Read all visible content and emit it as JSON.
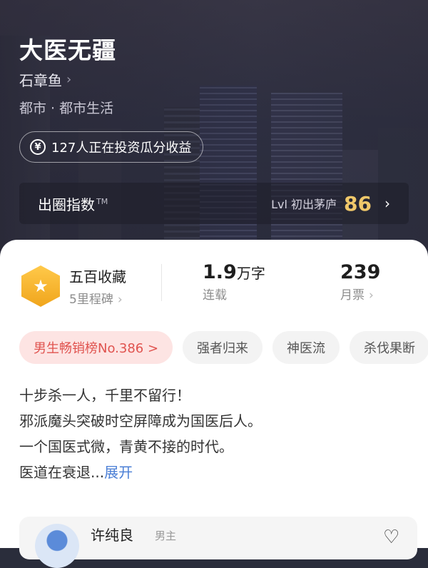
{
  "book": {
    "title": "大医无疆",
    "author": "石章鱼",
    "genre": "都市 · 都市生活",
    "invest_text": "127人正在投资瓜分收益"
  },
  "index": {
    "label": "出圈指数",
    "tm": "TM",
    "level": "Lvl 初出茅庐",
    "score": "86"
  },
  "stats": {
    "collect_title": "五百收藏",
    "collect_sub": "5里程碑",
    "words_num": "1.9",
    "words_unit": "万字",
    "status": "连载",
    "tickets_num": "239",
    "tickets_label": "月票"
  },
  "tags": [
    "男生畅销榜No.386 >",
    "强者归来",
    "神医流",
    "杀伐果断"
  ],
  "synopsis": {
    "lines": [
      "十步杀一人，千里不留行！",
      "邪派魔头突破时空屏障成为国医后人。",
      "一个国医式微，青黄不接的时代。",
      "医道在衰退..."
    ],
    "expand": "展开"
  },
  "comment": {
    "name": "许纯良",
    "role": "男主"
  }
}
